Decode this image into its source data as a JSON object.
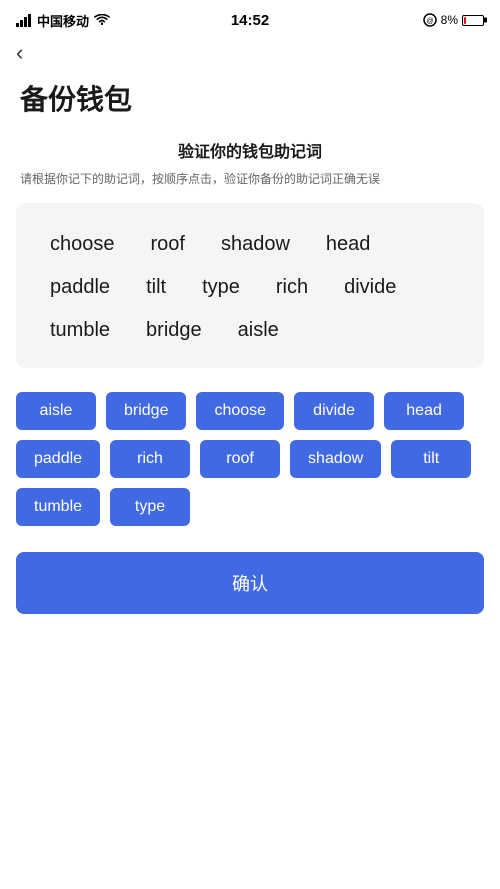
{
  "statusBar": {
    "carrier": "中国移动",
    "time": "14:52",
    "battery_percent": "8%"
  },
  "nav": {
    "back_arrow": "‹"
  },
  "page": {
    "title": "备份钱包",
    "section_heading": "验证你的钱包助记词",
    "section_desc": "请根据你记下的助记词，按顺序点击，验证你备份的助记词正确无误"
  },
  "display_words": [
    "choose",
    "roof",
    "shadow",
    "head",
    "paddle",
    "tilt",
    "type",
    "rich",
    "divide",
    "tumble",
    "bridge",
    "aisle"
  ],
  "word_buttons": [
    "aisle",
    "bridge",
    "choose",
    "divide",
    "head",
    "paddle",
    "rich",
    "roof",
    "shadow",
    "tilt",
    "tumble",
    "type"
  ],
  "confirm_btn_label": "确认"
}
